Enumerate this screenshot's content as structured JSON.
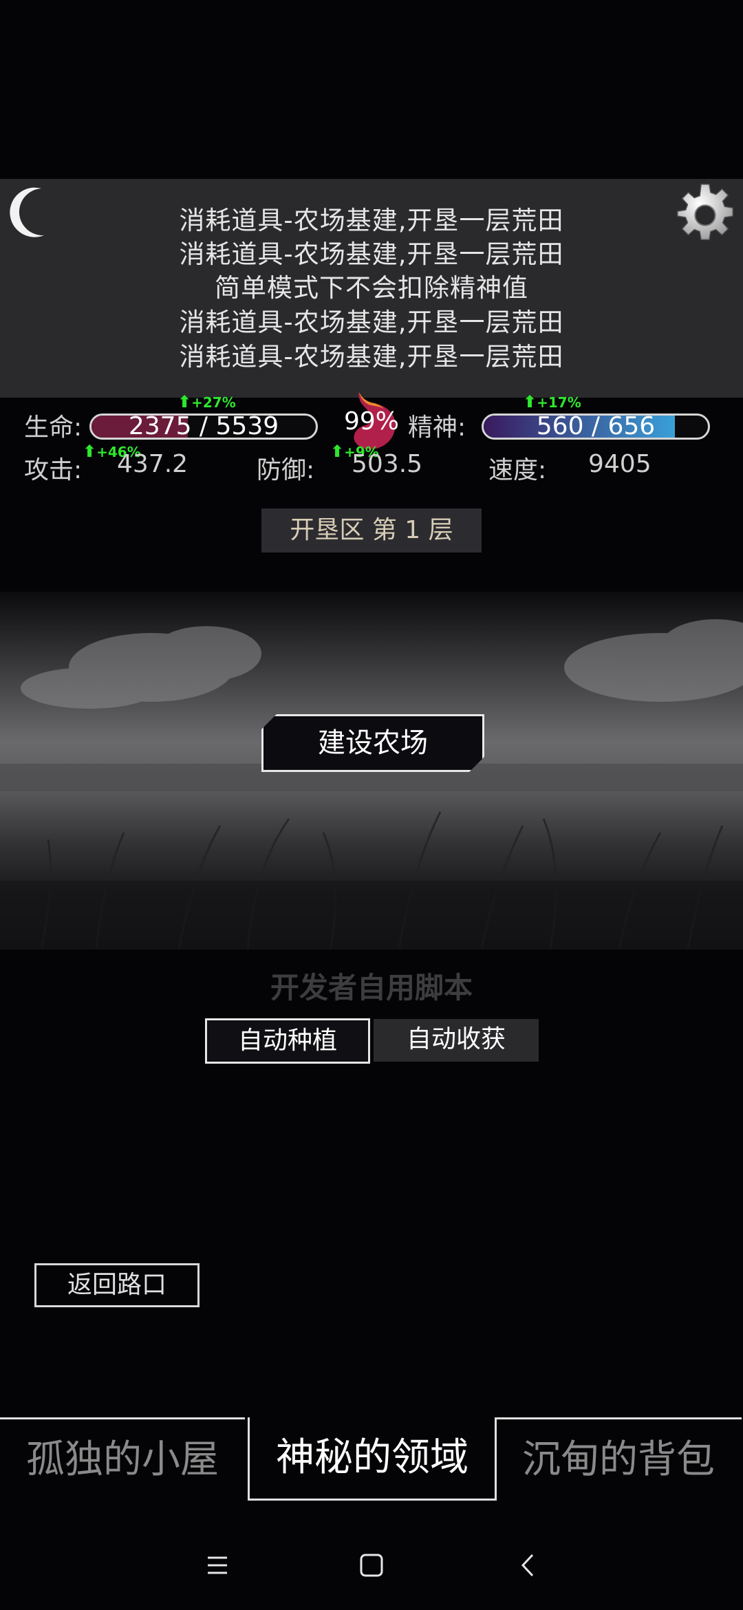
{
  "messages": [
    "消耗道具-农场基建,开垦一层荒田",
    "消耗道具-农场基建,开垦一层荒田",
    "简单模式下不会扣除精神值",
    "消耗道具-农场基建,开垦一层荒田",
    "消耗道具-农场基建,开垦一层荒田"
  ],
  "stats": {
    "life_label": "生命:",
    "life_value": "2375 / 5539",
    "life_fraction": 0.429,
    "life_boost": "+27%",
    "hunger": "99%",
    "spirit_label": "精神:",
    "spirit_value": "560 / 656",
    "spirit_fraction": 0.854,
    "spirit_boost": "+17%",
    "attack_label": "攻击:",
    "attack_value": "437.2",
    "attack_boost": "+46%",
    "defense_label": "防御:",
    "defense_value": "503.5",
    "defense_boost": "+9%",
    "speed_label": "速度:",
    "speed_value": "9405"
  },
  "area_title": "开垦区 第 1 层",
  "build_button": "建设农场",
  "dev_section": {
    "title": "开发者自用脚本",
    "auto_plant": "自动种植",
    "auto_harvest": "自动收获"
  },
  "return_button": "返回路口",
  "tabs": [
    "孤独的小屋",
    "神秘的领域",
    "沉甸的背包"
  ],
  "colors": {
    "life_bar": "#6b1c3a",
    "spirit_bar": "#3aa0d8",
    "boost": "#2ee62e"
  },
  "icons": [
    "moon-icon",
    "gear-icon",
    "stomach-icon",
    "menu-icon",
    "home-icon",
    "back-icon"
  ]
}
